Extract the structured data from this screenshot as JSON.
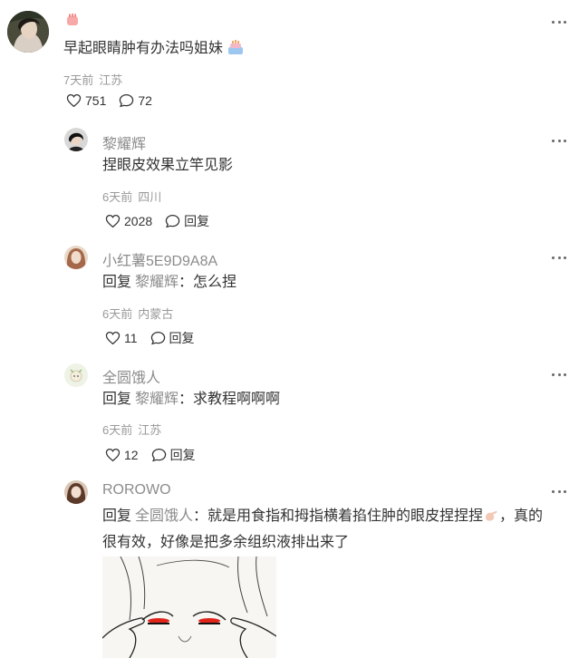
{
  "main_comment": {
    "text": "早起眼睛肿有办法吗姐妹",
    "time": "7天前",
    "location": "江苏",
    "likes": "751",
    "comments": "72"
  },
  "replies": [
    {
      "author": "黎耀辉",
      "text": "捏眼皮效果立竿见影",
      "time": "6天前",
      "location": "四川",
      "likes": "2028",
      "reply_label": "回复"
    },
    {
      "author": "小红薯5E9D9A8A",
      "reply_prefix": "回复",
      "reply_to": "黎耀辉",
      "text": "：怎么捏",
      "time": "6天前",
      "location": "内蒙古",
      "likes": "11",
      "reply_label": "回复"
    },
    {
      "author": "全圆饿人",
      "reply_prefix": "回复",
      "reply_to": "黎耀辉",
      "text": "：求教程啊啊啊",
      "time": "6天前",
      "location": "江苏",
      "likes": "12",
      "reply_label": "回复"
    },
    {
      "author": "ROROWO",
      "reply_prefix": "回复",
      "reply_to": "全圆饿人",
      "text_line1": "：就是用食指和拇指横着掐住肿的眼皮捏捏捏",
      "text_line1_tail": "，真的",
      "text_line2": "很有效，好像是把多余组织液排出来了"
    }
  ],
  "colors": {
    "text": "#333333",
    "secondary": "#8c8c8c",
    "meta": "#999999",
    "eyelid_red": "#e0241a"
  }
}
